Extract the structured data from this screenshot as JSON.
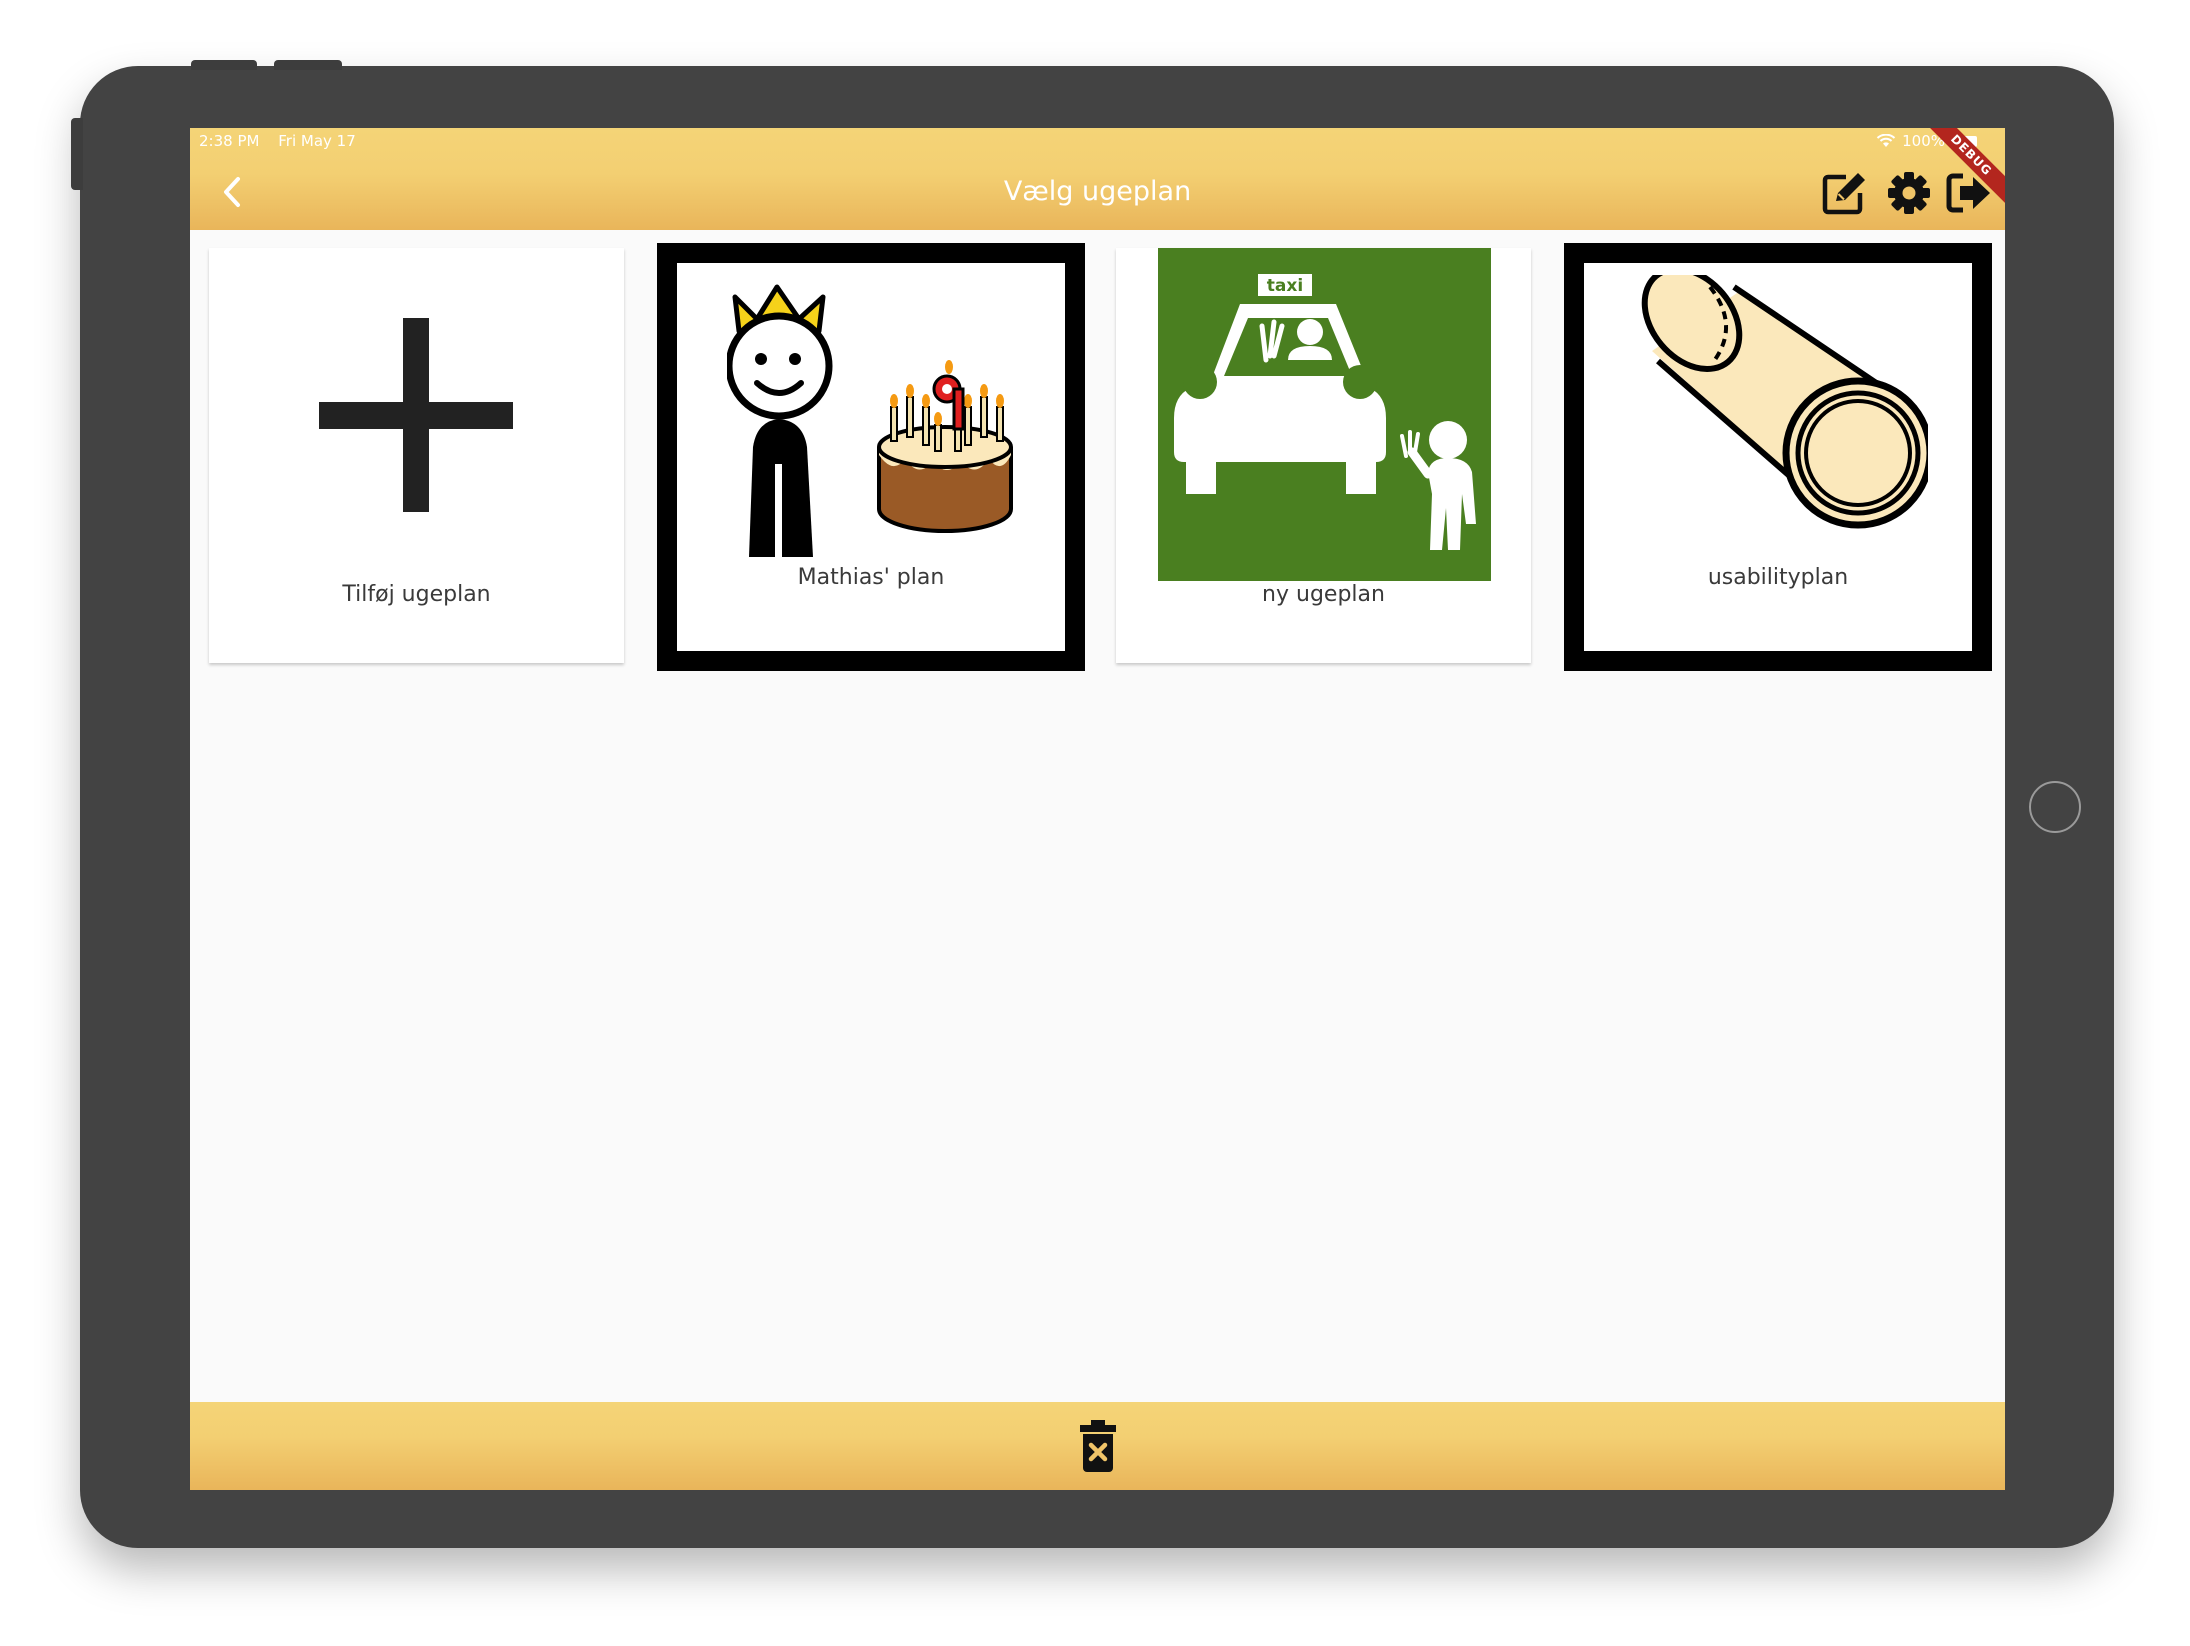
{
  "status_bar": {
    "time": "2:38 PM",
    "date": "Fri May 17",
    "battery": "100%",
    "debug_label": "DEBUG"
  },
  "appbar": {
    "title": "Vælg ugeplan",
    "icons": [
      "back-chevron-icon",
      "edit-icon",
      "gear-icon",
      "logout-icon"
    ]
  },
  "tiles": [
    {
      "label": "Tilføj ugeplan",
      "icon": "plus-icon",
      "selected": false
    },
    {
      "label": "Mathias' plan",
      "icon": "birthday-king-pictogram",
      "selected": true
    },
    {
      "label": "ny ugeplan",
      "icon": "taxi-pictogram",
      "selected": false
    },
    {
      "label": "usabilityplan",
      "icon": "log-pictogram",
      "selected": true
    }
  ],
  "bottombar": {
    "icons": [
      "trash-delete-icon"
    ]
  },
  "colors": {
    "appbar_top": "#f4d477",
    "appbar_bottom": "#e9b55a",
    "device_frame": "#434343",
    "taxi_green": "#4a7f20",
    "selection_border": "#000000"
  }
}
